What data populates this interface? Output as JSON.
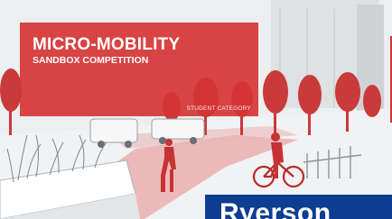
{
  "banner": {
    "title": "MICRO-MOBILITY",
    "subtitle": "SANDBOX COMPETITION",
    "category": "STUDENT CATEGORY"
  },
  "brand": {
    "text": "Ryerson"
  },
  "colors": {
    "accent_red": "#d63434",
    "brand_blue": "#0f3d91",
    "sketch_background": "#eef0f1"
  }
}
